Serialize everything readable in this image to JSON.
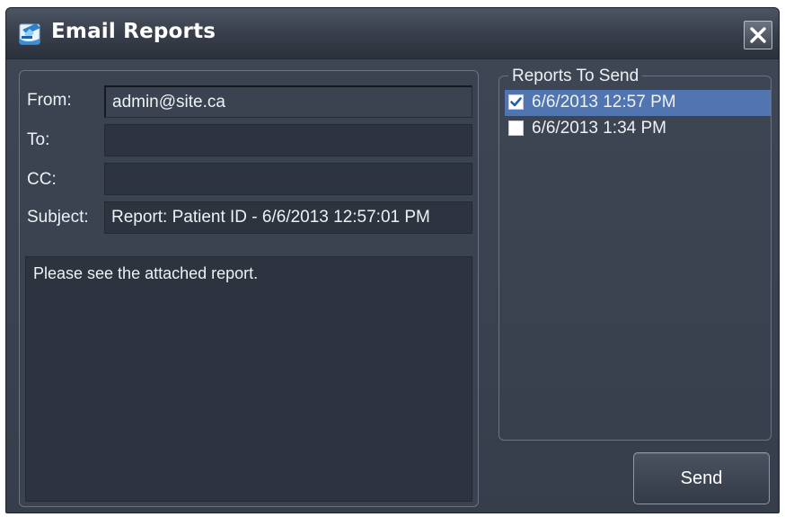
{
  "window": {
    "title": "Email Reports",
    "icon": "email-report-icon",
    "close_icon": "close-icon"
  },
  "form": {
    "from_label": "From:",
    "from_value": "admin@site.ca",
    "to_label": "To:",
    "to_value": "",
    "cc_label": "CC:",
    "cc_value": "",
    "subject_label": "Subject:",
    "subject_value": "Report: Patient ID - 6/6/2013 12:57:01 PM",
    "message": "Please see the attached report."
  },
  "reports": {
    "legend": "Reports To Send",
    "items": [
      {
        "label": "6/6/2013 12:57 PM",
        "checked": true,
        "selected": true
      },
      {
        "label": "6/6/2013 1:34 PM",
        "checked": false,
        "selected": false
      }
    ]
  },
  "actions": {
    "send_label": "Send"
  },
  "colors": {
    "window_bg": "#3a4250",
    "selection": "#5175b0",
    "field_bg": "#2d3440",
    "text": "#eef1f5"
  }
}
